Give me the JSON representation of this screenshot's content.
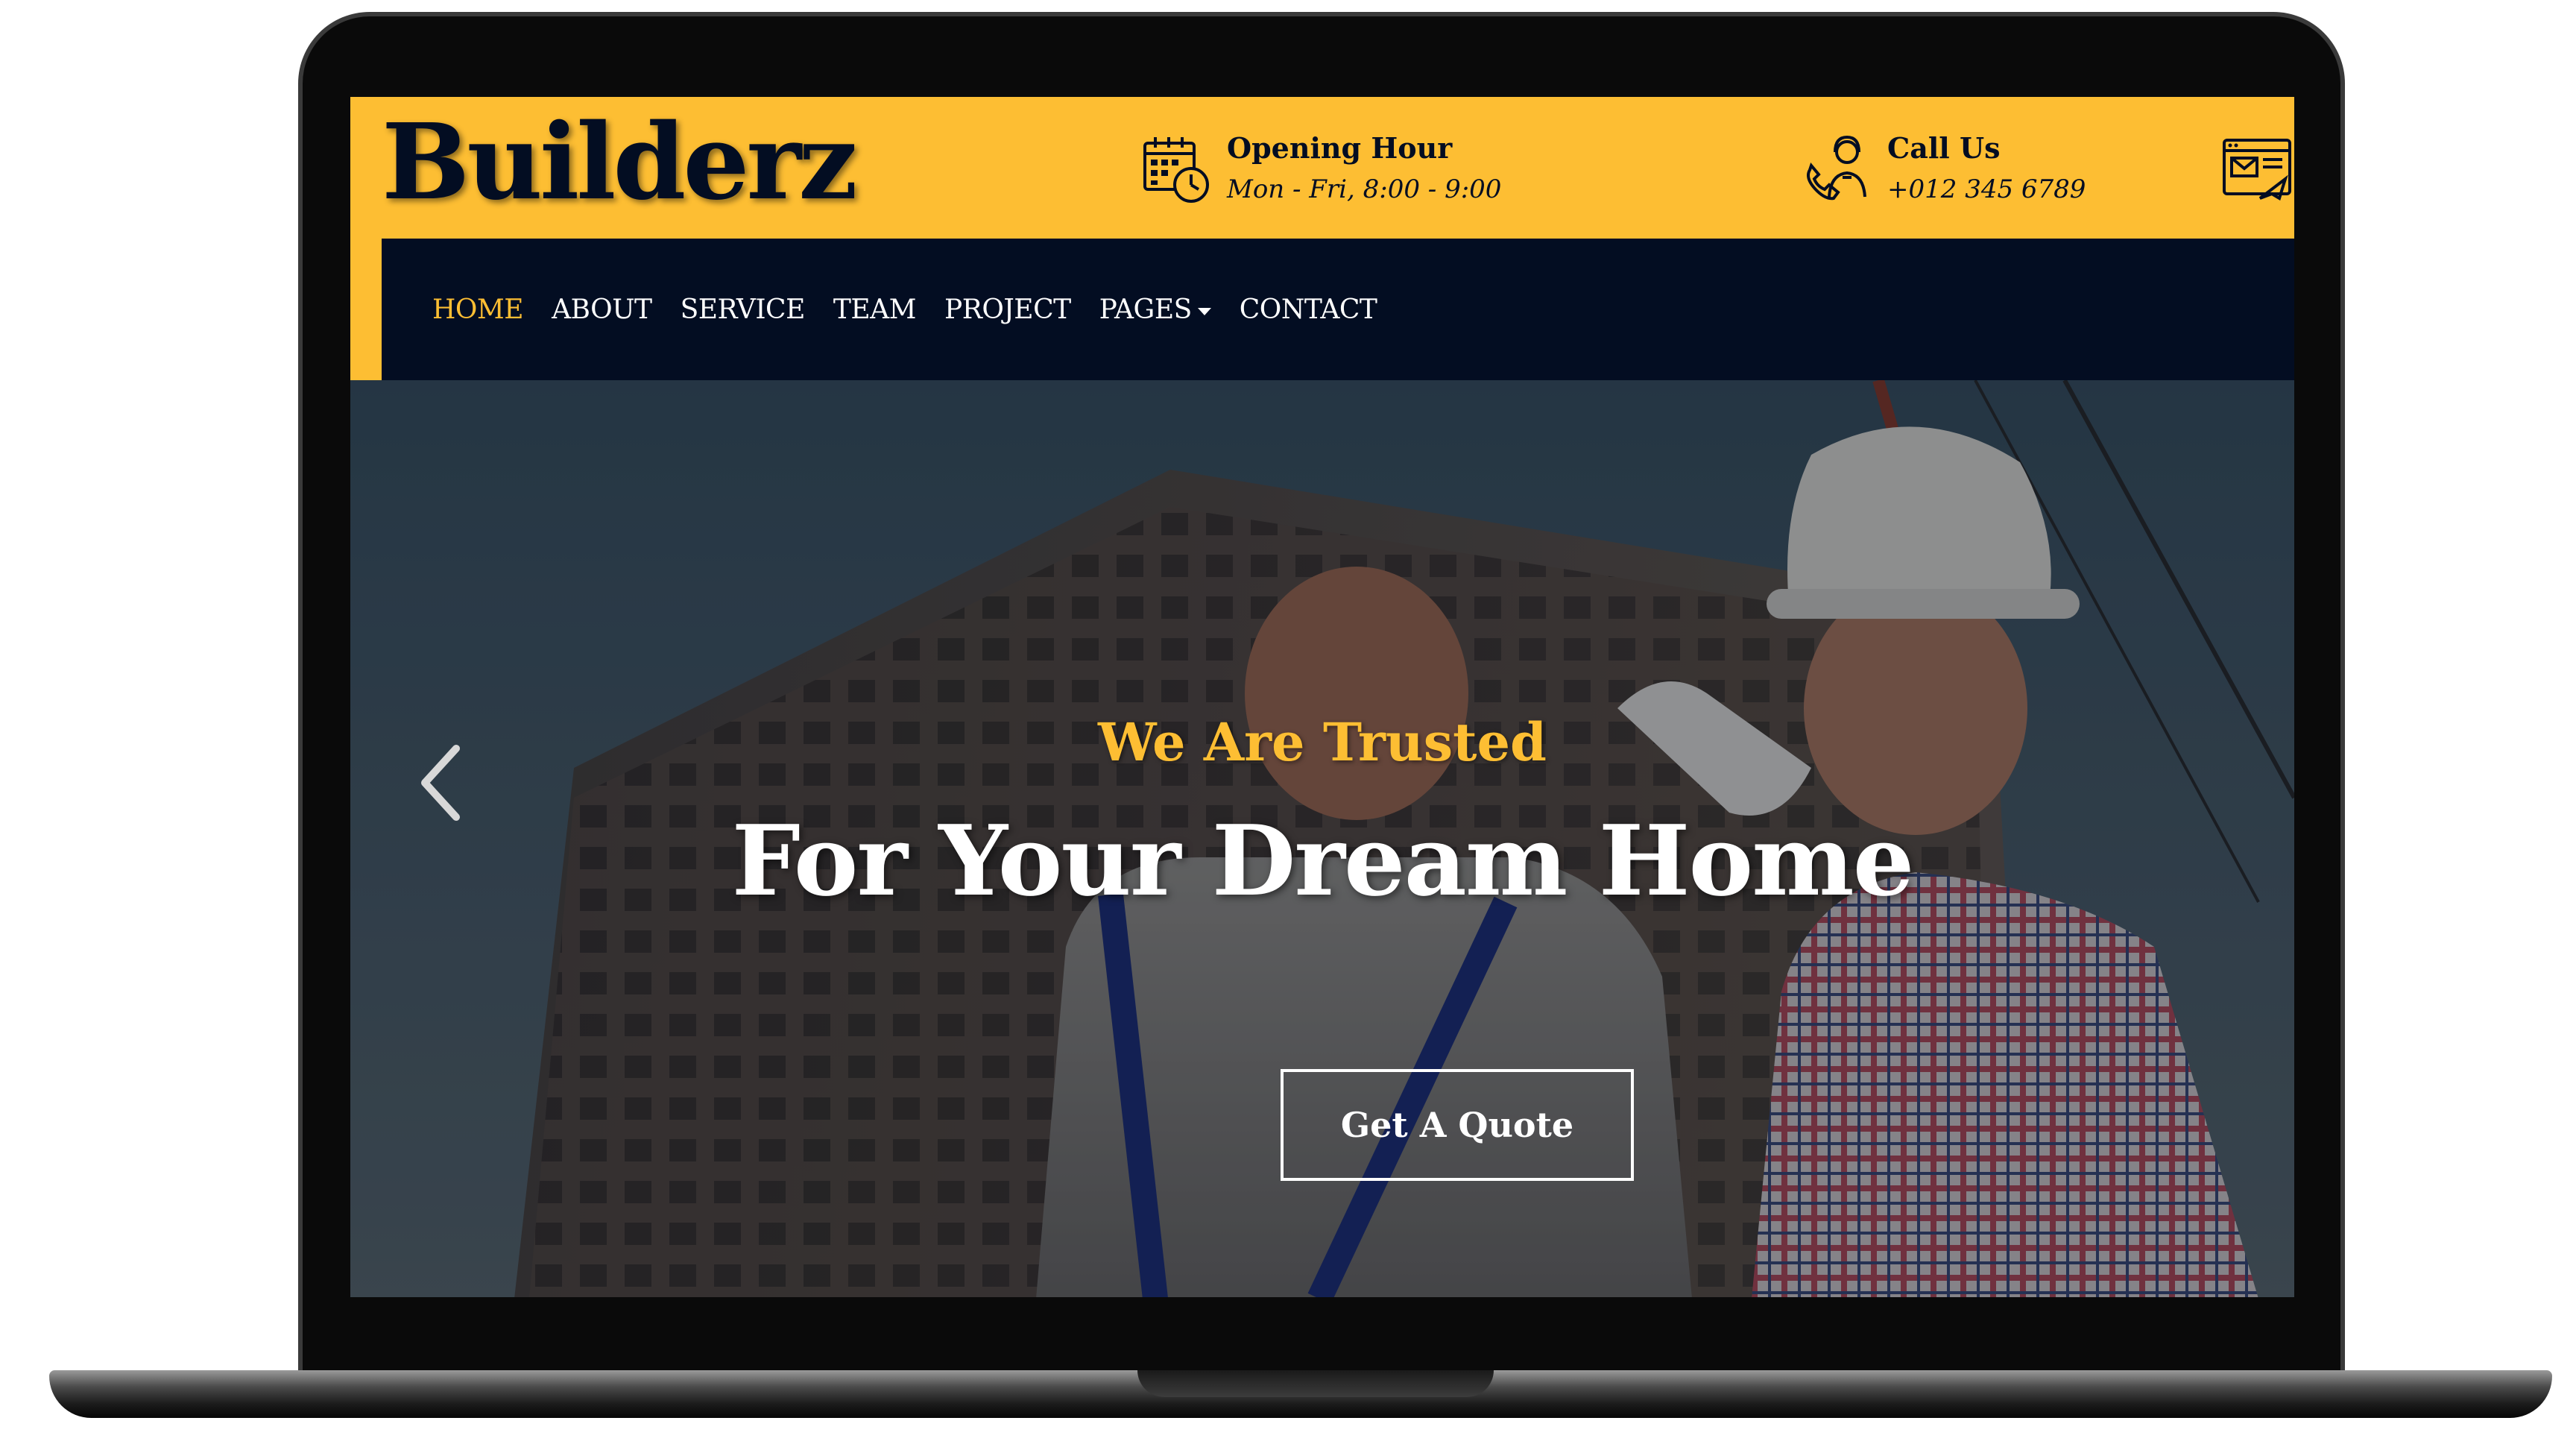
{
  "brand": {
    "name": "Builderz"
  },
  "header": {
    "opening": {
      "title": "Opening Hour",
      "text": "Mon - Fri, 8:00 - 9:00",
      "icon": "calendar-clock-icon"
    },
    "call": {
      "title": "Call Us",
      "text": "+012 345 6789",
      "icon": "phone-support-icon"
    },
    "email_icon": "email-browser-icon"
  },
  "nav": {
    "items": [
      {
        "label": "HOME",
        "active": true
      },
      {
        "label": "ABOUT"
      },
      {
        "label": "SERVICE"
      },
      {
        "label": "TEAM"
      },
      {
        "label": "PROJECT"
      },
      {
        "label": "PAGES",
        "dropdown": true
      },
      {
        "label": "CONTACT"
      }
    ]
  },
  "hero": {
    "subtitle": "We Are Trusted",
    "title": "For Your Dream Home",
    "button": "Get A Quote"
  },
  "colors": {
    "accent": "#fdbe33",
    "dark": "#030d22",
    "text_light": "#ffffff"
  }
}
